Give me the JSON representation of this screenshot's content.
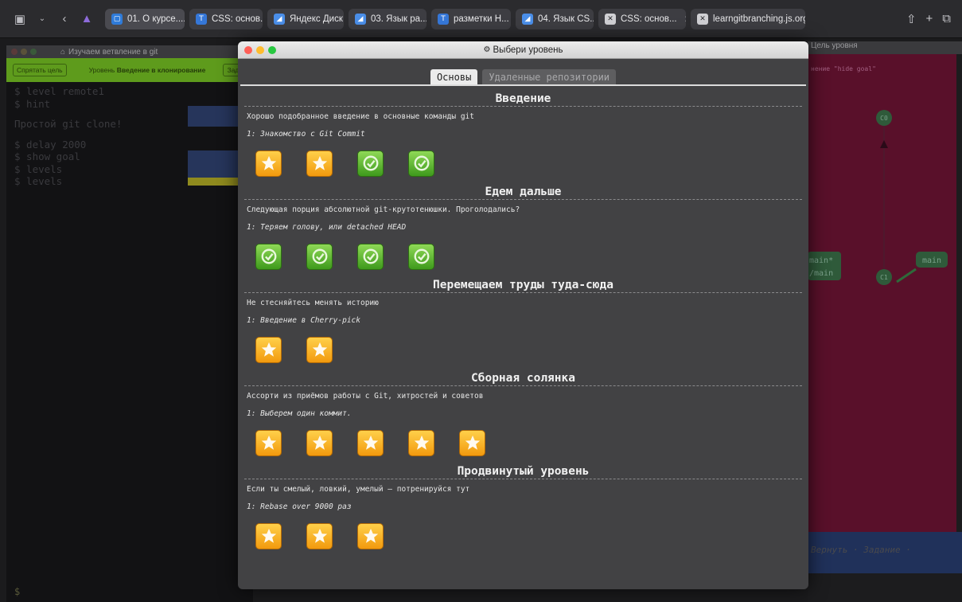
{
  "browser": {
    "tabs": [
      {
        "label": "01. О курсе....",
        "icon": "doc-icon",
        "active": true
      },
      {
        "label": "CSS: основ...",
        "icon": "t-icon"
      },
      {
        "label": "Яндекс Диск",
        "icon": "disk-icon"
      },
      {
        "label": "03. Язык ра...",
        "icon": "disk-icon"
      },
      {
        "label": "разметки Н...",
        "icon": "t-icon"
      },
      {
        "label": "04. Язык CS...",
        "icon": "disk-icon"
      },
      {
        "label": "CSS: основ...",
        "icon": "x-icon",
        "extra": ":S..."
      },
      {
        "label": "learngitbranching.js.org",
        "icon": "x-icon",
        "current": true
      }
    ]
  },
  "left_app": {
    "title": "Изучаем ветвление в git",
    "hide_goal_button": "Спрятать цель",
    "level_prefix": "Уровень",
    "level_name": "Введение в клонирование",
    "right_button": "Зада",
    "terminal": [
      {
        "text": "$ level remote1"
      },
      {
        "text": "$ hint"
      },
      {
        "text": ""
      },
      {
        "text": "Простой git clone!"
      },
      {
        "text": ""
      },
      {
        "text": "$ delay 2000"
      },
      {
        "text": "$ show goal"
      },
      {
        "text": "$ levels"
      },
      {
        "text": "$ levels"
      }
    ],
    "prompt": "$"
  },
  "right_app": {
    "title": "Цель уровня",
    "goal_text": "нение \"hide goal\"",
    "nodes": {
      "c0": "C0",
      "c1": "C1",
      "main": "main",
      "main_star": "main*",
      "remote_main": "/main"
    },
    "commands": "Вернуть · Задание ·"
  },
  "modal": {
    "title": "Выбери уровень",
    "tabs": [
      {
        "label": "Основы",
        "active": true
      },
      {
        "label": "Удаленные репозитории",
        "active": false
      }
    ],
    "sections": [
      {
        "heading": "Введение",
        "description": "Хорошо подобранное введение в основные команды git",
        "first_level": "1: Знакомство с Git Commit",
        "levels": [
          "star",
          "star",
          "done",
          "done"
        ]
      },
      {
        "heading": "Едем дальше",
        "description": "Следующая порция абсолютной git-крутотенюшки. Проголодались?",
        "first_level": "1: Теряем голову, или detached HEAD",
        "levels": [
          "done",
          "done",
          "done",
          "done"
        ]
      },
      {
        "heading": "Перемещаем труды туда-сюда",
        "description": "Не стесняйтесь менять историю",
        "first_level": "1: Введение в Cherry-pick",
        "levels": [
          "star",
          "star"
        ]
      },
      {
        "heading": "Сборная солянка",
        "description": "Ассорти из приёмов работы с Git, хитростей и советов",
        "first_level": "1: Выберем один коммит.",
        "levels": [
          "star",
          "star",
          "star",
          "star",
          "star"
        ]
      },
      {
        "heading": "Продвинутый уровень",
        "description": "Если ты смелый, ловкий, умелый – потренируйся тут",
        "first_level": "1: Rebase over 9000 раз",
        "levels": [
          "star",
          "star",
          "star"
        ]
      }
    ]
  }
}
